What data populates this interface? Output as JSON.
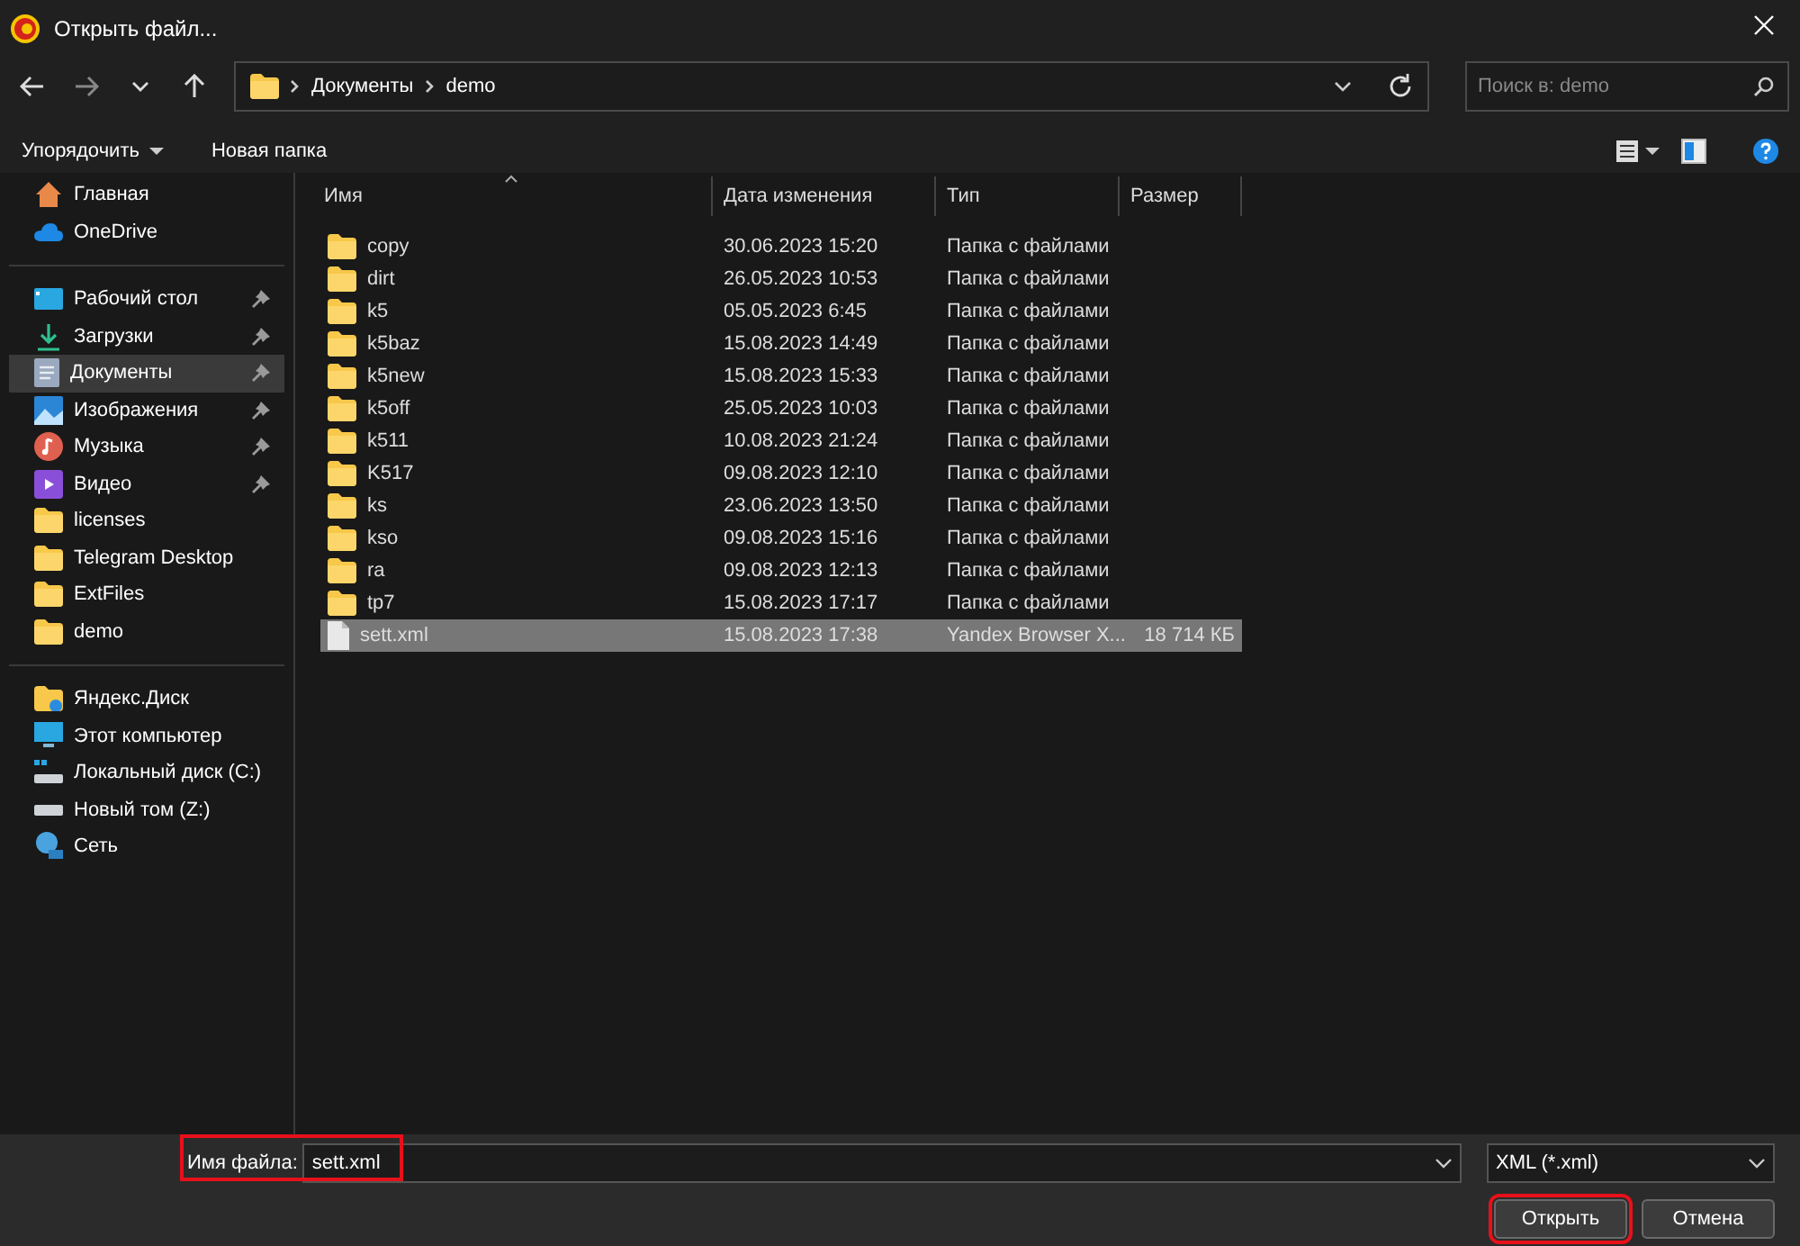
{
  "window": {
    "title": "Открыть файл..."
  },
  "address_bar": {
    "path": [
      "Документы",
      "demo"
    ]
  },
  "search": {
    "placeholder": "Поиск в: demo"
  },
  "toolbar": {
    "organize": "Упорядочить",
    "new_folder": "Новая папка"
  },
  "sidebar": {
    "groups": [
      [
        {
          "label": "Главная",
          "kind": "home",
          "pinned": false,
          "selected": false
        },
        {
          "label": "OneDrive",
          "kind": "cloud",
          "pinned": false,
          "selected": false
        }
      ],
      [
        {
          "label": "Рабочий стол",
          "kind": "desktop",
          "pinned": true,
          "selected": false
        },
        {
          "label": "Загрузки",
          "kind": "download",
          "pinned": true,
          "selected": false
        },
        {
          "label": "Документы",
          "kind": "document",
          "pinned": true,
          "selected": true
        },
        {
          "label": "Изображения",
          "kind": "picture",
          "pinned": true,
          "selected": false
        },
        {
          "label": "Музыка",
          "kind": "music",
          "pinned": true,
          "selected": false
        },
        {
          "label": "Видео",
          "kind": "video",
          "pinned": true,
          "selected": false
        },
        {
          "label": "licenses",
          "kind": "folder",
          "pinned": false,
          "selected": false
        },
        {
          "label": "Telegram Desktop",
          "kind": "folder",
          "pinned": false,
          "selected": false
        },
        {
          "label": "ExtFiles",
          "kind": "folder",
          "pinned": false,
          "selected": false
        },
        {
          "label": "demo",
          "kind": "folder",
          "pinned": false,
          "selected": false
        }
      ],
      [
        {
          "label": "Яндекс.Диск",
          "kind": "folder-cloud",
          "pinned": false,
          "selected": false
        },
        {
          "label": "Этот компьютер",
          "kind": "monitor",
          "pinned": false,
          "selected": false,
          "children": [
            {
              "label": "Локальный диск (C:)",
              "kind": "drive-system",
              "pinned": false,
              "selected": false
            },
            {
              "label": "Новый том (Z:)",
              "kind": "drive",
              "pinned": false,
              "selected": false
            }
          ]
        },
        {
          "label": "Сеть",
          "kind": "network",
          "pinned": false,
          "selected": false
        }
      ]
    ]
  },
  "table": {
    "columns": [
      "Имя",
      "Дата изменения",
      "Тип",
      "Размер"
    ],
    "rows": [
      {
        "kind": "folder",
        "name": "copy",
        "date": "30.06.2023 15:20",
        "type": "Папка с файлами",
        "selected": false
      },
      {
        "kind": "folder",
        "name": "dirt",
        "date": "26.05.2023 10:53",
        "type": "Папка с файлами",
        "selected": false
      },
      {
        "kind": "folder",
        "name": "k5",
        "date": "05.05.2023 6:45",
        "type": "Папка с файлами",
        "selected": false
      },
      {
        "kind": "folder",
        "name": "k5baz",
        "date": "15.08.2023 14:49",
        "type": "Папка с файлами",
        "selected": false
      },
      {
        "kind": "folder",
        "name": "k5new",
        "date": "15.08.2023 15:33",
        "type": "Папка с файлами",
        "selected": false
      },
      {
        "kind": "folder",
        "name": "k5off",
        "date": "25.05.2023 10:03",
        "type": "Папка с файлами",
        "selected": false
      },
      {
        "kind": "folder",
        "name": "k511",
        "date": "10.08.2023 21:24",
        "type": "Папка с файлами",
        "selected": false
      },
      {
        "kind": "folder",
        "name": "K517",
        "date": "09.08.2023 12:10",
        "type": "Папка с файлами",
        "selected": false
      },
      {
        "kind": "folder",
        "name": "ks",
        "date": "23.06.2023 13:50",
        "type": "Папка с файлами",
        "selected": false
      },
      {
        "kind": "folder",
        "name": "kso",
        "date": "09.08.2023 15:16",
        "type": "Папка с файлами",
        "selected": false
      },
      {
        "kind": "folder",
        "name": "ra",
        "date": "09.08.2023 12:13",
        "type": "Папка с файлами",
        "selected": false
      },
      {
        "kind": "folder",
        "name": "tp7",
        "date": "15.08.2023 17:17",
        "type": "Папка с файлами",
        "selected": false
      },
      {
        "kind": "file",
        "name": "sett.xml",
        "date": "15.08.2023 17:38",
        "type": "Yandex Browser X...",
        "size": "18 714 КБ",
        "selected": true
      }
    ]
  },
  "bottom": {
    "filename_label": "Имя файла:",
    "filename": "sett.xml",
    "filter": "XML (*.xml)",
    "open": "Открыть",
    "cancel": "Отмена",
    "highlighted": true
  }
}
